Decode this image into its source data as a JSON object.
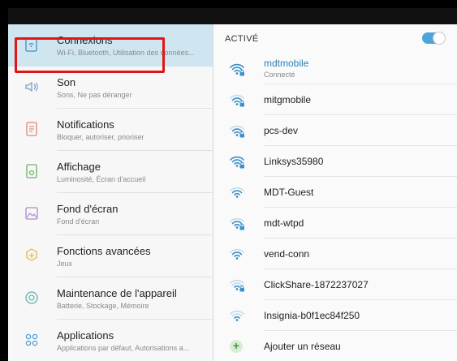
{
  "menu": {
    "items": [
      {
        "title": "Connexions",
        "subtitle": "Wi-Fi, Bluetooth, Utilisation des données..."
      },
      {
        "title": "Son",
        "subtitle": "Sons, Ne pas déranger"
      },
      {
        "title": "Notifications",
        "subtitle": "Bloquer, autoriser, prioriser"
      },
      {
        "title": "Affichage",
        "subtitle": "Luminosité, Écran d'accueil"
      },
      {
        "title": "Fond d'écran",
        "subtitle": "Fond d'écran"
      },
      {
        "title": "Fonctions avancées",
        "subtitle": "Jeux"
      },
      {
        "title": "Maintenance de l'appareil",
        "subtitle": "Batterie, Stockage, Mémoire"
      },
      {
        "title": "Applications",
        "subtitle": "Applications par défaut, Autorisations a..."
      }
    ]
  },
  "wifi": {
    "active_label": "ACTIVÉ",
    "enabled": true,
    "networks": [
      {
        "name": "mdtmobile",
        "status": "Connecté",
        "locked": true,
        "signal": 3
      },
      {
        "name": "mitgmobile",
        "status": "",
        "locked": true,
        "signal": 2
      },
      {
        "name": "pcs-dev",
        "status": "",
        "locked": true,
        "signal": 2
      },
      {
        "name": "Linksys35980",
        "status": "",
        "locked": true,
        "signal": 3
      },
      {
        "name": "MDT-Guest",
        "status": "",
        "locked": false,
        "signal": 2
      },
      {
        "name": "mdt-wtpd",
        "status": "",
        "locked": true,
        "signal": 2
      },
      {
        "name": "vend-conn",
        "status": "",
        "locked": false,
        "signal": 2
      },
      {
        "name": "ClickShare-1872237027",
        "status": "",
        "locked": true,
        "signal": 1
      },
      {
        "name": "Insignia-b0f1ec84f250",
        "status": "",
        "locked": false,
        "signal": 1
      }
    ],
    "add_network_label": "Ajouter un réseau"
  },
  "colors": {
    "accent": "#4ea5d9",
    "selected_bg": "#cfe6f1",
    "highlight_box": "#e01515",
    "connected_text": "#2b7fb8"
  }
}
